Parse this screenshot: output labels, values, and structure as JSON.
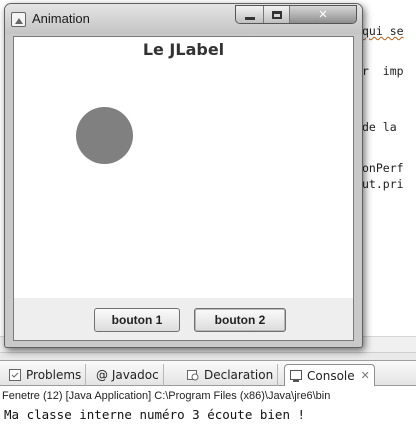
{
  "editor": {
    "code_lines": [
      "qui se",
      "r  imp",
      "de la",
      "onPerf",
      "ut.pri"
    ]
  },
  "views": {
    "tabs": [
      {
        "icon": "problems-icon",
        "label": "Problems"
      },
      {
        "icon": "javadoc-icon",
        "label": "@ Javadoc"
      },
      {
        "icon": "declaration-icon",
        "label": "Declaration"
      },
      {
        "icon": "console-icon",
        "label": "Console",
        "active": true
      }
    ],
    "console_path": "Fenetre (12) [Java Application] C:\\Program Files (x86)\\Java\\jre6\\bin",
    "console_output": "Ma classe interne numéro 3 écoute bien !"
  },
  "window": {
    "title": "Animation",
    "label_text": "Le JLabel",
    "circle_color": "#808080",
    "buttons": [
      {
        "label": "bouton 1"
      },
      {
        "label": "bouton 2"
      }
    ]
  }
}
